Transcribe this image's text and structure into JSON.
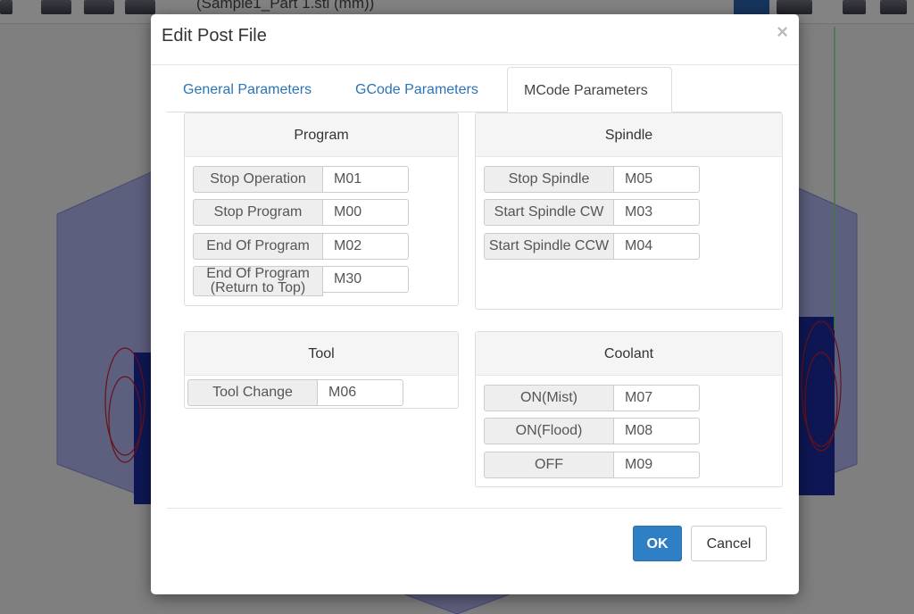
{
  "background": {
    "title_text": "(Sample1_Part 1.stl (mm))"
  },
  "dialog": {
    "title": "Edit Post File",
    "close_glyph": "×",
    "tabs": [
      {
        "label": "General Parameters",
        "active": false
      },
      {
        "label": "GCode Parameters",
        "active": false
      },
      {
        "label": "MCode Parameters",
        "active": true
      }
    ],
    "program": {
      "heading": "Program",
      "rows": [
        {
          "label": "Stop Operation",
          "value": "M01"
        },
        {
          "label": "Stop Program",
          "value": "M00"
        },
        {
          "label": "End Of Program",
          "value": "M02"
        },
        {
          "label": "End Of Program\n(Return to Top)",
          "value": "M30"
        }
      ]
    },
    "spindle": {
      "heading": "Spindle",
      "rows": [
        {
          "label": "Stop Spindle",
          "value": "M05"
        },
        {
          "label": "Start Spindle CW",
          "value": "M03"
        },
        {
          "label": "Start Spindle CCW",
          "value": "M04"
        }
      ]
    },
    "tool": {
      "heading": "Tool",
      "rows": [
        {
          "label": "Tool Change",
          "value": "M06"
        }
      ]
    },
    "coolant": {
      "heading": "Coolant",
      "rows": [
        {
          "label": "ON(Mist)",
          "value": "M07"
        },
        {
          "label": "ON(Flood)",
          "value": "M08"
        },
        {
          "label": "OFF",
          "value": "M09"
        }
      ]
    },
    "buttons": {
      "ok_label": "OK",
      "cancel_label": "Cancel"
    }
  },
  "colors": {
    "primary": "#2f7fc4",
    "tab_link": "#2a74b8"
  }
}
